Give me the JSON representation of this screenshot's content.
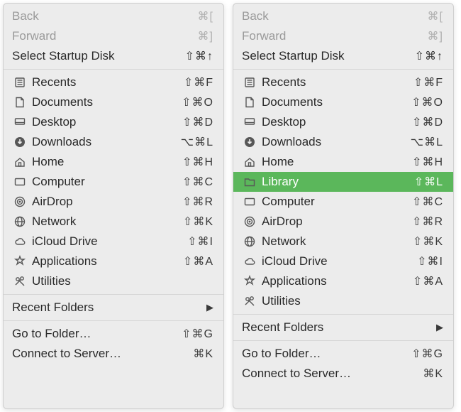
{
  "menus": [
    {
      "id": "left",
      "groups": [
        [
          {
            "icon": null,
            "name": "back",
            "label": "Back",
            "shortcut": "⌘[",
            "state": "disabled"
          },
          {
            "icon": null,
            "name": "forward",
            "label": "Forward",
            "shortcut": "⌘]",
            "state": "disabled"
          },
          {
            "icon": null,
            "name": "select-startup-disk",
            "label": "Select Startup Disk",
            "shortcut": "⇧⌘↑"
          }
        ],
        [
          {
            "icon": "recents",
            "name": "recents",
            "label": "Recents",
            "shortcut": "⇧⌘F"
          },
          {
            "icon": "documents",
            "name": "documents",
            "label": "Documents",
            "shortcut": "⇧⌘O"
          },
          {
            "icon": "desktop",
            "name": "desktop",
            "label": "Desktop",
            "shortcut": "⇧⌘D"
          },
          {
            "icon": "downloads",
            "name": "downloads",
            "label": "Downloads",
            "shortcut": "⌥⌘L"
          },
          {
            "icon": "home",
            "name": "home",
            "label": "Home",
            "shortcut": "⇧⌘H"
          },
          {
            "icon": "computer",
            "name": "computer",
            "label": "Computer",
            "shortcut": "⇧⌘C"
          },
          {
            "icon": "airdrop",
            "name": "airdrop",
            "label": "AirDrop",
            "shortcut": "⇧⌘R"
          },
          {
            "icon": "network",
            "name": "network",
            "label": "Network",
            "shortcut": "⇧⌘K"
          },
          {
            "icon": "icloud",
            "name": "icloud-drive",
            "label": "iCloud Drive",
            "shortcut": "⇧⌘I"
          },
          {
            "icon": "apps",
            "name": "applications",
            "label": "Applications",
            "shortcut": "⇧⌘A"
          },
          {
            "icon": "utilities",
            "name": "utilities",
            "label": "Utilities",
            "shortcut": ""
          }
        ],
        [
          {
            "icon": null,
            "name": "recent-folders",
            "label": "Recent Folders",
            "submenu": true
          }
        ],
        [
          {
            "icon": null,
            "name": "go-to-folder",
            "label": "Go to Folder…",
            "shortcut": "⇧⌘G"
          },
          {
            "icon": null,
            "name": "connect-to-server",
            "label": "Connect to Server…",
            "shortcut": "⌘K"
          }
        ]
      ]
    },
    {
      "id": "right",
      "groups": [
        [
          {
            "icon": null,
            "name": "back",
            "label": "Back",
            "shortcut": "⌘[",
            "state": "disabled"
          },
          {
            "icon": null,
            "name": "forward",
            "label": "Forward",
            "shortcut": "⌘]",
            "state": "disabled"
          },
          {
            "icon": null,
            "name": "select-startup-disk",
            "label": "Select Startup Disk",
            "shortcut": "⇧⌘↑"
          }
        ],
        [
          {
            "icon": "recents",
            "name": "recents",
            "label": "Recents",
            "shortcut": "⇧⌘F"
          },
          {
            "icon": "documents",
            "name": "documents",
            "label": "Documents",
            "shortcut": "⇧⌘O"
          },
          {
            "icon": "desktop",
            "name": "desktop",
            "label": "Desktop",
            "shortcut": "⇧⌘D"
          },
          {
            "icon": "downloads",
            "name": "downloads",
            "label": "Downloads",
            "shortcut": "⌥⌘L"
          },
          {
            "icon": "home",
            "name": "home",
            "label": "Home",
            "shortcut": "⇧⌘H"
          },
          {
            "icon": "folder",
            "name": "library",
            "label": "Library",
            "shortcut": "⇧⌘L",
            "state": "selected"
          },
          {
            "icon": "computer",
            "name": "computer",
            "label": "Computer",
            "shortcut": "⇧⌘C"
          },
          {
            "icon": "airdrop",
            "name": "airdrop",
            "label": "AirDrop",
            "shortcut": "⇧⌘R"
          },
          {
            "icon": "network",
            "name": "network",
            "label": "Network",
            "shortcut": "⇧⌘K"
          },
          {
            "icon": "icloud",
            "name": "icloud-drive",
            "label": "iCloud Drive",
            "shortcut": "⇧⌘I"
          },
          {
            "icon": "apps",
            "name": "applications",
            "label": "Applications",
            "shortcut": "⇧⌘A"
          },
          {
            "icon": "utilities",
            "name": "utilities",
            "label": "Utilities",
            "shortcut": ""
          }
        ],
        [
          {
            "icon": null,
            "name": "recent-folders",
            "label": "Recent Folders",
            "submenu": true
          }
        ],
        [
          {
            "icon": null,
            "name": "go-to-folder",
            "label": "Go to Folder…",
            "shortcut": "⇧⌘G"
          },
          {
            "icon": null,
            "name": "connect-to-server",
            "label": "Connect to Server…",
            "shortcut": "⌘K"
          }
        ]
      ]
    }
  ]
}
